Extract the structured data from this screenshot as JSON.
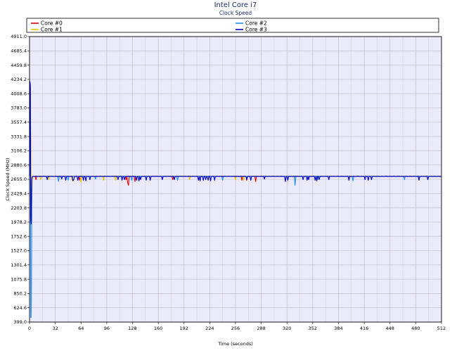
{
  "chart_data": {
    "type": "line",
    "title": "Intel Core i7",
    "subtitle": "Clock Speed",
    "xlabel": "Time (seconds)",
    "ylabel": "Clock Speed (MHz)",
    "xlim": [
      0,
      512
    ],
    "ylim": [
      399.0,
      4911.0
    ],
    "x_ticks": [
      0,
      32,
      64,
      96,
      128,
      160,
      192,
      224,
      256,
      288,
      320,
      352,
      384,
      416,
      448,
      480,
      512
    ],
    "y_ticks": [
      399.0,
      624.6,
      850.2,
      1075.8,
      1301.4,
      1527.0,
      1752.6,
      1978.2,
      2203.8,
      2429.4,
      2655.0,
      2880.6,
      3106.2,
      3331.8,
      3557.4,
      3783.0,
      4008.6,
      4234.2,
      4459.8,
      4685.4,
      4911.0
    ],
    "grid": true,
    "legend": "top",
    "baseline": 2700,
    "series": [
      {
        "name": "Core #0",
        "color": "#e00000",
        "initial": [
          [
            0,
            2700
          ],
          [
            1,
            4100
          ],
          [
            2,
            2000
          ],
          [
            3,
            2650
          ]
        ],
        "dips": [
          [
            8,
            2650
          ],
          [
            62,
            2640
          ],
          [
            120,
            2650
          ],
          [
            122,
            2600
          ],
          [
            123,
            2560
          ],
          [
            131,
            2620
          ],
          [
            178,
            2650
          ],
          [
            264,
            2640
          ],
          [
            270,
            2640
          ],
          [
            281,
            2620
          ]
        ]
      },
      {
        "name": "Core #1",
        "color": "#f0c000",
        "initial": [
          [
            0,
            2700
          ],
          [
            1,
            4000
          ],
          [
            2,
            2100
          ],
          [
            3,
            2650
          ]
        ],
        "dips": [
          [
            14,
            2650
          ],
          [
            24,
            2650
          ],
          [
            53,
            2630
          ],
          [
            64,
            2610
          ],
          [
            92,
            2640
          ],
          [
            107,
            2640
          ],
          [
            199,
            2650
          ],
          [
            256,
            2650
          ],
          [
            266,
            2640
          ],
          [
            330,
            2640
          ]
        ]
      },
      {
        "name": "Core #2",
        "color": "#1e90ff",
        "initial": [
          [
            0,
            2700
          ],
          [
            1,
            3900
          ],
          [
            1.5,
            470
          ],
          [
            2,
            470
          ],
          [
            2.5,
            1200
          ],
          [
            3,
            2680
          ]
        ],
        "dips": [
          [
            36,
            2620
          ],
          [
            48,
            2640
          ],
          [
            82,
            2660
          ],
          [
            127,
            2640
          ],
          [
            184,
            2640
          ],
          [
            240,
            2640
          ],
          [
            330,
            2560
          ],
          [
            358,
            2650
          ],
          [
            402,
            2630
          ],
          [
            466,
            2650
          ]
        ]
      },
      {
        "name": "Core #3",
        "color": "#0000c0",
        "initial": [
          [
            0,
            2700
          ],
          [
            0.5,
            4200
          ],
          [
            1,
            4150
          ],
          [
            1.5,
            2000
          ],
          [
            2,
            1950
          ],
          [
            2.5,
            2500
          ],
          [
            3,
            2690
          ]
        ],
        "dips": [
          [
            22,
            2650
          ],
          [
            40,
            2660
          ],
          [
            45,
            2640
          ],
          [
            54,
            2630
          ],
          [
            55,
            2650
          ],
          [
            60,
            2640
          ],
          [
            67,
            2640
          ],
          [
            70,
            2630
          ],
          [
            75,
            2650
          ],
          [
            110,
            2650
          ],
          [
            115,
            2640
          ],
          [
            118,
            2650
          ],
          [
            133,
            2640
          ],
          [
            136,
            2630
          ],
          [
            138,
            2650
          ],
          [
            145,
            2640
          ],
          [
            150,
            2640
          ],
          [
            165,
            2650
          ],
          [
            180,
            2650
          ],
          [
            210,
            2640
          ],
          [
            212,
            2630
          ],
          [
            216,
            2640
          ],
          [
            219,
            2650
          ],
          [
            222,
            2640
          ],
          [
            225,
            2630
          ],
          [
            230,
            2640
          ],
          [
            270,
            2650
          ],
          [
            275,
            2640
          ],
          [
            292,
            2660
          ],
          [
            318,
            2620
          ],
          [
            321,
            2640
          ],
          [
            340,
            2650
          ],
          [
            345,
            2640
          ],
          [
            347,
            2650
          ],
          [
            355,
            2640
          ],
          [
            357,
            2630
          ],
          [
            360,
            2650
          ],
          [
            372,
            2650
          ],
          [
            397,
            2640
          ],
          [
            417,
            2650
          ],
          [
            421,
            2640
          ],
          [
            425,
            2650
          ],
          [
            484,
            2640
          ],
          [
            495,
            2650
          ]
        ]
      }
    ]
  }
}
